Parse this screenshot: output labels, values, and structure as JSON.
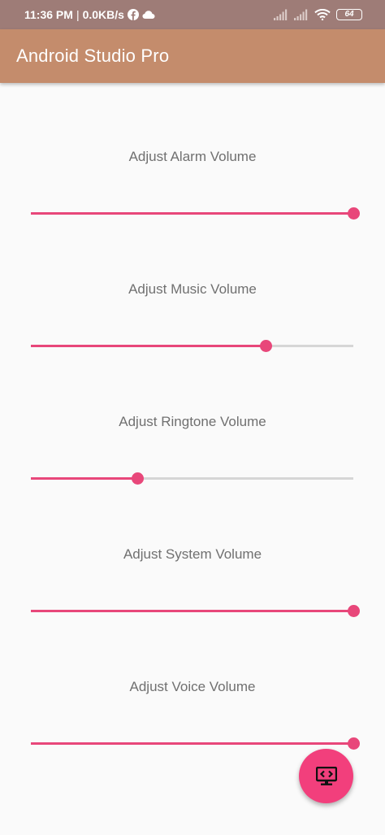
{
  "status_bar": {
    "time": "11:36 PM",
    "separator": "|",
    "speed": "0.0KB/s",
    "battery": "64",
    "icons": [
      "facebook-icon",
      "cloud-icon",
      "signal-icon",
      "signal-icon",
      "wifi-icon",
      "battery-icon"
    ]
  },
  "app_bar": {
    "title": "Android Studio Pro",
    "color": "#c48c6c"
  },
  "volumes": [
    {
      "label": "Adjust Alarm Volume",
      "level": 1.0
    },
    {
      "label": "Adjust Music Volume",
      "level": 0.73
    },
    {
      "label": "Adjust Ringtone Volume",
      "level": 0.33
    },
    {
      "label": "Adjust System Volume",
      "level": 1.0
    },
    {
      "label": "Adjust Voice Volume",
      "level": 1.0
    }
  ],
  "colors": {
    "accent": "#e8477a",
    "track": "#d6d6d6",
    "fab": "#f23f7c",
    "status_bar": "#9e7c77"
  },
  "fab": {
    "icon": "code-monitor-icon"
  }
}
